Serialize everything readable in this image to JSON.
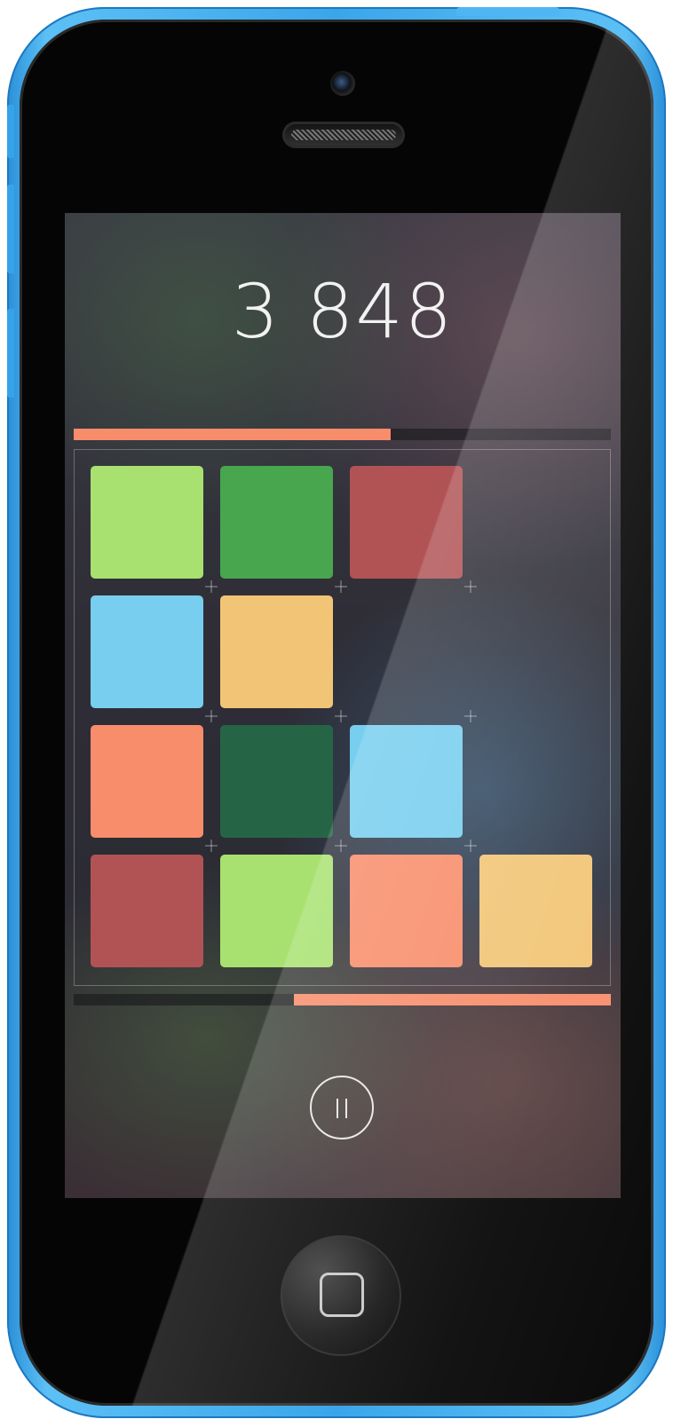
{
  "game": {
    "score": "3 848",
    "top_progress": 0.59,
    "bottom_progress": 0.59,
    "grid": {
      "rows": 4,
      "cols": 4,
      "tiles": [
        {
          "row": 0,
          "col": 0,
          "color": "#a8e170"
        },
        {
          "row": 0,
          "col": 1,
          "color": "#48a64f"
        },
        {
          "row": 0,
          "col": 2,
          "color": "#b15355"
        },
        {
          "row": 1,
          "col": 0,
          "color": "#77ceef"
        },
        {
          "row": 1,
          "col": 1,
          "color": "#f2c576"
        },
        {
          "row": 2,
          "col": 0,
          "color": "#f88d6b"
        },
        {
          "row": 2,
          "col": 1,
          "color": "#256546"
        },
        {
          "row": 2,
          "col": 2,
          "color": "#77ceef"
        },
        {
          "row": 3,
          "col": 0,
          "color": "#b15355"
        },
        {
          "row": 3,
          "col": 1,
          "color": "#a8e170"
        },
        {
          "row": 3,
          "col": 2,
          "color": "#f88d6b"
        },
        {
          "row": 3,
          "col": 3,
          "color": "#f2c576"
        }
      ]
    }
  },
  "colors": {
    "progress_accent": "#f88d6b",
    "phone_body": "#3aa6ea"
  },
  "icons": {
    "pause": "pause-icon",
    "home": "home-button-icon"
  }
}
